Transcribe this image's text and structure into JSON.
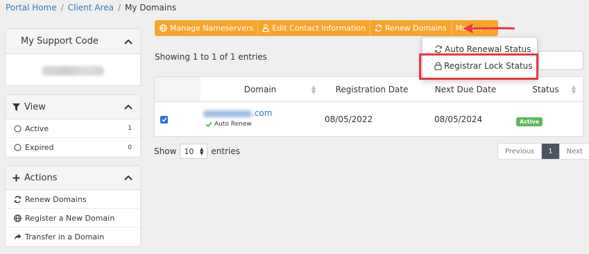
{
  "breadcrumb": {
    "home": "Portal Home",
    "client_area": "Client Area",
    "current": "My Domains",
    "sep": "/"
  },
  "sidebar": {
    "support": {
      "title": "My Support Code"
    },
    "view": {
      "title": "View",
      "items": [
        {
          "label": "Active",
          "count": "1"
        },
        {
          "label": "Expired",
          "count": "0"
        }
      ]
    },
    "actions": {
      "title": "Actions",
      "items": [
        {
          "label": "Renew Domains",
          "icon": "refresh-icon"
        },
        {
          "label": "Register a New Domain",
          "icon": "globe-icon"
        },
        {
          "label": "Transfer in a Domain",
          "icon": "share-icon"
        }
      ]
    }
  },
  "toolbar": {
    "manage_ns": "Manage Nameservers",
    "edit_contact": "Edit Contact Information",
    "renew": "Renew Domains",
    "more": "More..."
  },
  "dropdown": {
    "auto_renewal": "Auto Renewal Status",
    "registrar_lock": "Registrar Lock Status"
  },
  "table": {
    "showing": "Showing 1 to 1 of 1 entries",
    "headers": {
      "domain": "Domain",
      "registration_date": "Registration Date",
      "next_due_date": "Next Due Date",
      "status": "Status"
    },
    "rows": [
      {
        "domain_suffix": ".com",
        "auto_renew": "Auto Renew",
        "registration_date": "08/05/2022",
        "next_due_date": "08/05/2024",
        "status": "Active"
      }
    ]
  },
  "entries": {
    "show": "Show",
    "value": "10",
    "suffix": "entries"
  },
  "pagination": {
    "previous": "Previous",
    "page": "1",
    "next": "Next"
  },
  "colors": {
    "toolbar": "#f6a62c",
    "highlight": "#e8383d",
    "active_badge": "#5cb85c",
    "page_active": "#4a5361",
    "link": "#337ab7"
  }
}
